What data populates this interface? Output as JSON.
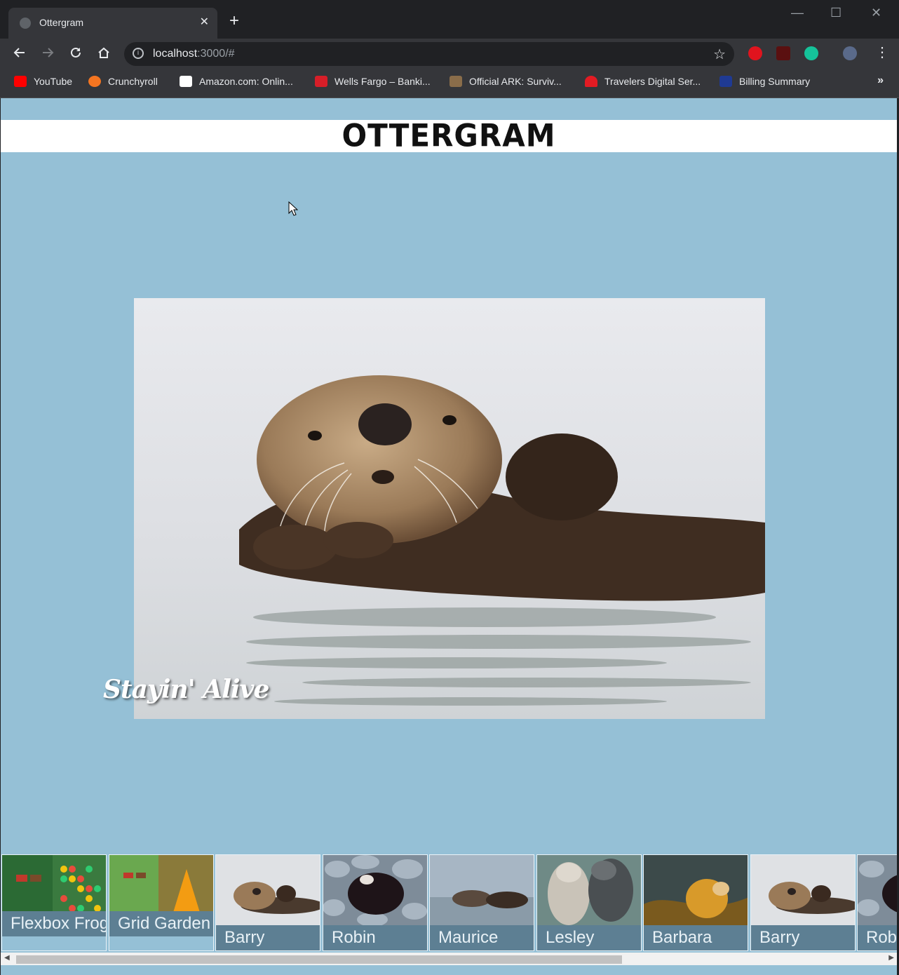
{
  "browser": {
    "tab_title": "Ottergram",
    "tab_close": "✕",
    "new_tab": "+",
    "url_host": "localhost",
    "url_rest": ":3000/#",
    "window_controls": [
      "—",
      "☐",
      "✕"
    ],
    "bookmarks": [
      {
        "label": "YouTube",
        "icon": "youtube-icon",
        "color": "#ff0000"
      },
      {
        "label": "Crunchyroll",
        "icon": "crunchyroll-icon",
        "color": "#f47521"
      },
      {
        "label": "Amazon.com: Onlin...",
        "icon": "amazon-icon",
        "color": "#ffffff"
      },
      {
        "label": "Wells Fargo – Banki...",
        "icon": "wellsfargo-icon",
        "color": "#d71e28"
      },
      {
        "label": "Official ARK: Surviv...",
        "icon": "ark-icon",
        "color": "#8a6d4a"
      },
      {
        "label": "Travelers Digital Ser...",
        "icon": "travelers-umbrella-icon",
        "color": "#e31b23"
      },
      {
        "label": "Billing Summary",
        "icon": "billing-icon",
        "color": "#1f3a93"
      }
    ],
    "bookmarks_more": "»"
  },
  "page": {
    "logo": "OTTERGRAM",
    "detail_title": "Stayin' Alive",
    "thumbnails": [
      {
        "label": "Flexbox Froggy",
        "type": "froggy"
      },
      {
        "label": "Grid Garden",
        "type": "garden"
      },
      {
        "label": "Barry",
        "type": "otter-float"
      },
      {
        "label": "Robin",
        "type": "otter-rocks"
      },
      {
        "label": "Maurice",
        "type": "otter-water"
      },
      {
        "label": "Lesley",
        "type": "otter-pair"
      },
      {
        "label": "Barbara",
        "type": "otter-kelp"
      },
      {
        "label": "Barry",
        "type": "otter-float"
      },
      {
        "label": "Robin",
        "type": "otter-rocks"
      }
    ]
  },
  "colors": {
    "page_bg": "#95c0d6",
    "label_bg": "#5d7f93"
  }
}
